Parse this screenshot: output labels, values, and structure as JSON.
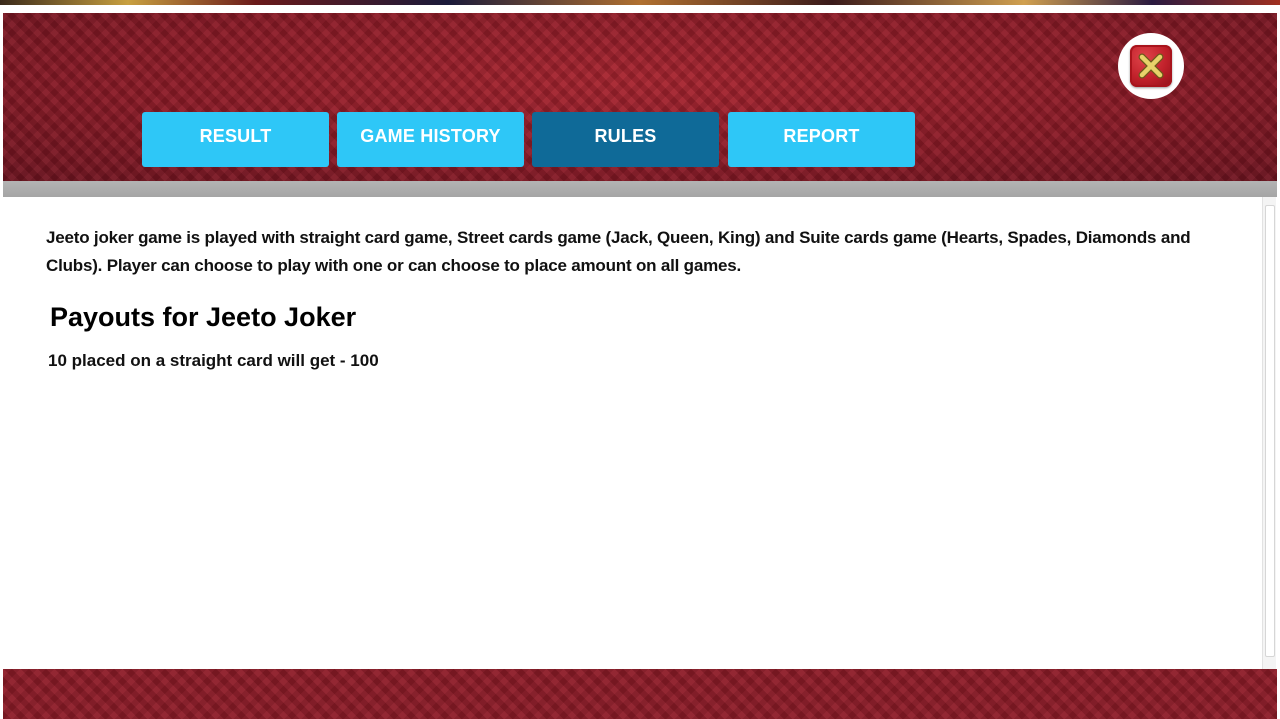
{
  "tabs": [
    {
      "label": "RESULT",
      "active": false
    },
    {
      "label": "GAME HISTORY",
      "active": false
    },
    {
      "label": "RULES",
      "active": true
    },
    {
      "label": "REPORT",
      "active": false
    }
  ],
  "close_button": {
    "icon": "close-icon"
  },
  "content": {
    "intro": "Jeeto joker game is played with straight card game, Street cards game (Jack, Queen, King) and Suite cards game (Hearts, Spades, Diamonds and Clubs). Player can choose to play with one or can choose to place amount on all games.",
    "payouts_heading": "Payouts for Jeeto Joker",
    "payout_line": "10 placed on a straight card will get - 100"
  },
  "colors": {
    "tab": "#2ec7f7",
    "tab_active": "#0f6a98",
    "header_bg": "#8e1c28",
    "close_red": "#c0202a"
  }
}
